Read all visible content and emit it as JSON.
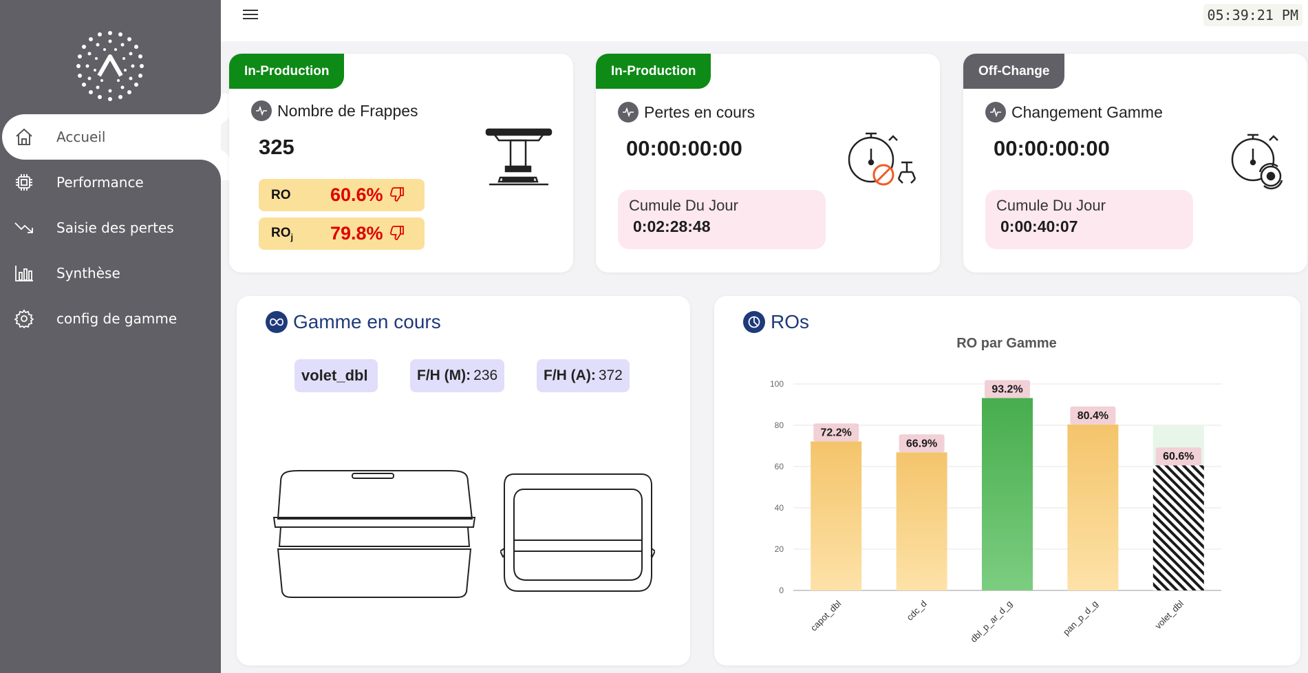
{
  "clock": "05:39:21 PM",
  "sidebar": {
    "items": [
      {
        "label": "Accueil"
      },
      {
        "label": "Performance"
      },
      {
        "label": "Saisie des pertes"
      },
      {
        "label": "Synthèse"
      },
      {
        "label": "config de gamme"
      }
    ]
  },
  "cards": {
    "frappes": {
      "status": "In-Production",
      "status_color": "#0e8a16",
      "title": "Nombre de Frappes",
      "value": "325",
      "ro_label": "RO",
      "ro_value": "60.6%",
      "roj_label": "RO",
      "roj_sub": "j",
      "roj_value": "79.8%"
    },
    "pertes": {
      "status": "In-Production",
      "status_color": "#0e8a16",
      "title": "Pertes en cours",
      "value": "00:00:00:00",
      "cumul_label": "Cumule Du Jour",
      "cumul_value": "0:02:28:48"
    },
    "changement": {
      "status": "Off-Change",
      "status_color": "#606066",
      "title": "Changement Gamme",
      "value": "00:00:00:00",
      "cumul_label": "Cumule Du Jour",
      "cumul_value": "0:00:40:07"
    }
  },
  "gamme": {
    "title": "Gamme en cours",
    "name": "volet_dbl",
    "fh_m_label": "F/H (M):",
    "fh_m_value": "236",
    "fh_a_label": "F/H (A):",
    "fh_a_value": "372"
  },
  "ros": {
    "title": "ROs"
  },
  "chart_data": {
    "type": "bar",
    "title": "RO par Gamme",
    "categories": [
      "capot_dbl",
      "cdc_d",
      "dbl_p_ar_d_g",
      "pan_p_d_g",
      "volet_dbl"
    ],
    "values": [
      72.2,
      66.9,
      93.2,
      80.4,
      60.6
    ],
    "data_labels": [
      "72.2%",
      "66.9%",
      "93.2%",
      "80.4%",
      "60.6%"
    ],
    "y_ticks": [
      "0",
      "20",
      "40",
      "60",
      "80",
      "100"
    ],
    "ylim": [
      0,
      100
    ],
    "grid": true,
    "colors": {
      "orange": "#f5c46d",
      "green": "#4caf50",
      "current_bg": "#e8f5e9"
    }
  }
}
